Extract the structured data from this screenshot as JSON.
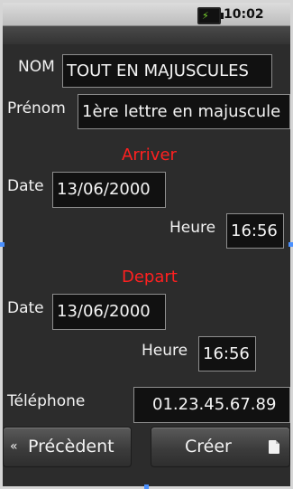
{
  "status_bar": {
    "time": "10:02 AM"
  },
  "form": {
    "nom": {
      "label": "NOM",
      "value": "TOUT EN MAJUSCULES"
    },
    "prenom": {
      "label": "Prénom",
      "value": "1ère lettre en majuscule"
    },
    "arrive": {
      "title": "Arriver",
      "date_label": "Date",
      "date_value": "13/06/2000",
      "time_label": "Heure",
      "time_value": "16:56"
    },
    "depart": {
      "title": "Depart",
      "date_label": "Date",
      "date_value": "13/06/2000",
      "time_label": "Heure",
      "time_value": "16:56"
    },
    "telephone": {
      "label": "Téléphone",
      "value": "01.23.45.67.89"
    }
  },
  "buttons": {
    "previous": "Précèdent",
    "create": "Créer"
  },
  "colors": {
    "section_title": "#ff2020",
    "background": "#2c2c2c",
    "field_bg": "#111111"
  },
  "icons": [
    "battery-charging-icon",
    "chevron-left-icon",
    "document-icon"
  ]
}
